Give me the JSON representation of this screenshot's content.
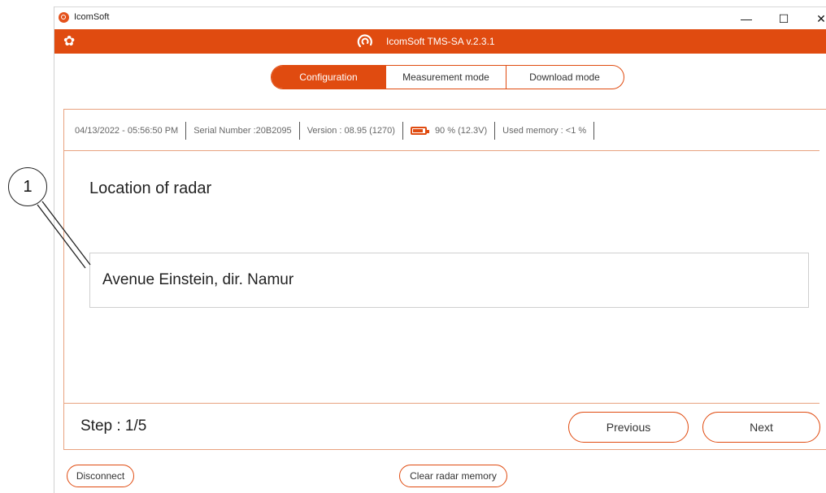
{
  "window": {
    "title": "IcomSoft",
    "minimize": "—",
    "maximize": "☐",
    "close": "✕"
  },
  "header": {
    "title": "IcomSoft TMS-SA   v.2.3.1",
    "gear_glyph": "✿",
    "accent_color": "#e04b10"
  },
  "tabs": [
    {
      "label": "Configuration",
      "active": true
    },
    {
      "label": "Measurement mode",
      "active": false
    },
    {
      "label": "Download mode",
      "active": false
    }
  ],
  "status": {
    "datetime": "04/13/2022 - 05:56:50 PM",
    "serial": "Serial Number :20B2095",
    "version": "Version : 08.95 (1270)",
    "battery": "90 %  (12.3V)",
    "memory": "Used memory : <1 %"
  },
  "main": {
    "page_title": "Location of radar",
    "location_value": "Avenue Einstein, dir. Namur",
    "step": "Step : 1/5",
    "previous_label": "Previous",
    "next_label": "Next"
  },
  "bottom": {
    "disconnect_label": "Disconnect",
    "clear_label": "Clear radar memory"
  },
  "callout": {
    "number": "1"
  }
}
